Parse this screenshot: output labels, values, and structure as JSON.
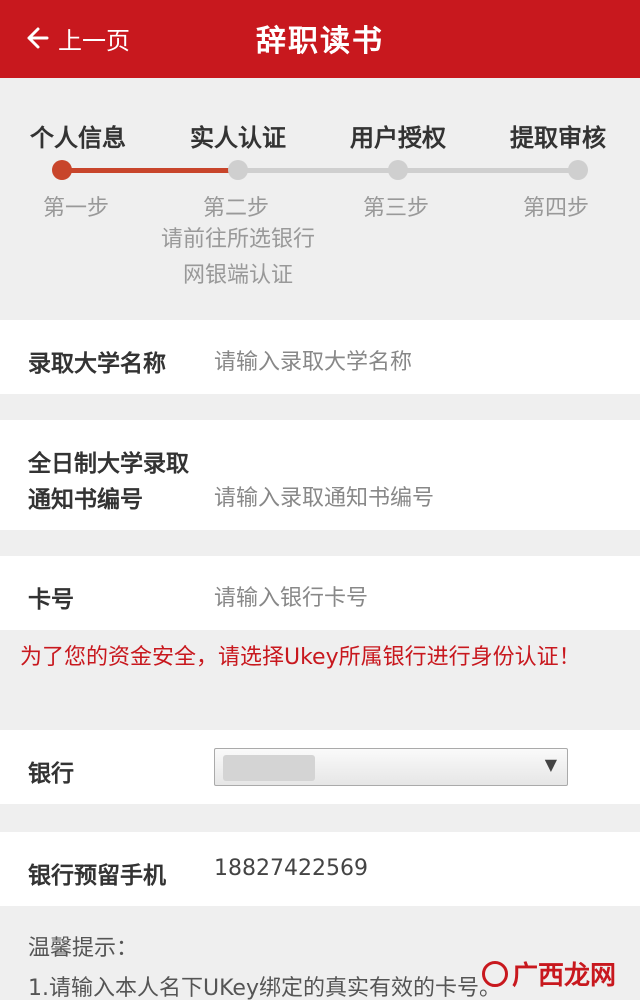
{
  "header": {
    "back_label": "上一页",
    "title": "辞职读书"
  },
  "steps": [
    {
      "title": "个人信息",
      "sub": "第一步",
      "active": true
    },
    {
      "title": "实人认证",
      "sub": "第二步",
      "active": false
    },
    {
      "title": "用户授权",
      "sub": "第三步",
      "active": false
    },
    {
      "title": "提取审核",
      "sub": "第四步",
      "active": false
    }
  ],
  "step_note": {
    "line1": "请前往所选银行",
    "line2": "网银端认证"
  },
  "form": {
    "university": {
      "label": "录取大学名称",
      "placeholder": "请输入录取大学名称"
    },
    "notice": {
      "label_line1": "全日制大学录取",
      "label_line2": "通知书编号",
      "placeholder": "请输入录取通知书编号"
    },
    "card": {
      "label": "卡号",
      "placeholder": "请输入银行卡号"
    },
    "warning": "为了您的资金安全，请选择Ukey所属银行进行身份认证！",
    "bank": {
      "label": "银行"
    },
    "phone": {
      "label": "银行预留手机",
      "value": "18827422569"
    }
  },
  "tips": {
    "title": "温馨提示：",
    "line1": "1.请输入本人名下UKey绑定的真实有效的卡号。"
  },
  "watermark": {
    "text": "广西龙网"
  },
  "colors": {
    "brand": "#c8181e",
    "step_active": "#c8452b",
    "step_inactive": "#cfcfcf"
  }
}
